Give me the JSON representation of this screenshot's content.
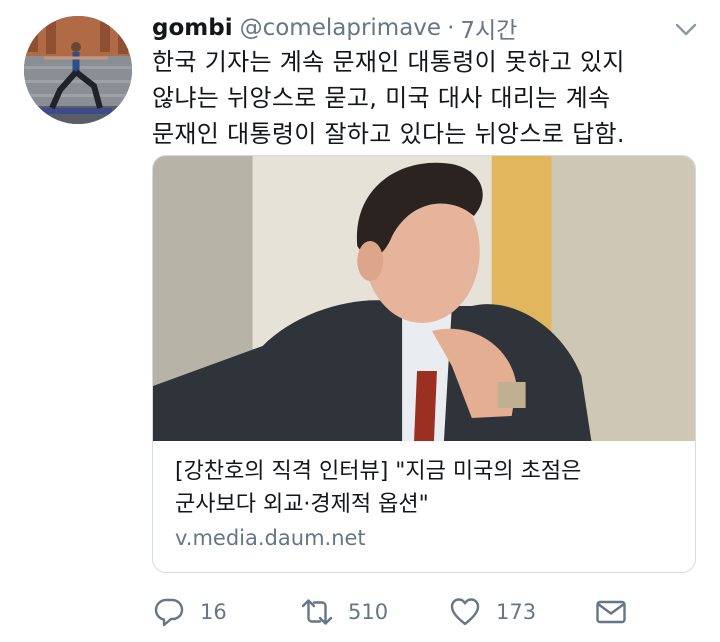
{
  "tweet": {
    "display_name": "gombi",
    "handle": "@comelaprimave",
    "separator": "·",
    "time": "7시간",
    "text_lines": [
      "한국 기자는 계속 문재인 대통령이 못하고 있지",
      "않냐는 뉘앙스로 묻고, 미국 대사 대리는 계속",
      "문재인 대통령이 잘하고 있다는 뉘앙스로 답함."
    ]
  },
  "card": {
    "title_lines": [
      "[강찬호의 직격 인터뷰] \"지금 미국의 초점은",
      "군사보다 외교·경제적 옵션\""
    ],
    "domain": "v.media.daum.net"
  },
  "actions": {
    "reply_count": "16",
    "retweet_count": "510",
    "like_count": "173"
  },
  "icons": {
    "more": "chevron-down-icon",
    "reply": "reply-icon",
    "retweet": "retweet-icon",
    "like": "heart-icon",
    "dm": "envelope-icon"
  },
  "colors": {
    "text": "#14171a",
    "secondary": "#657786",
    "border": "#d3dbe2"
  }
}
